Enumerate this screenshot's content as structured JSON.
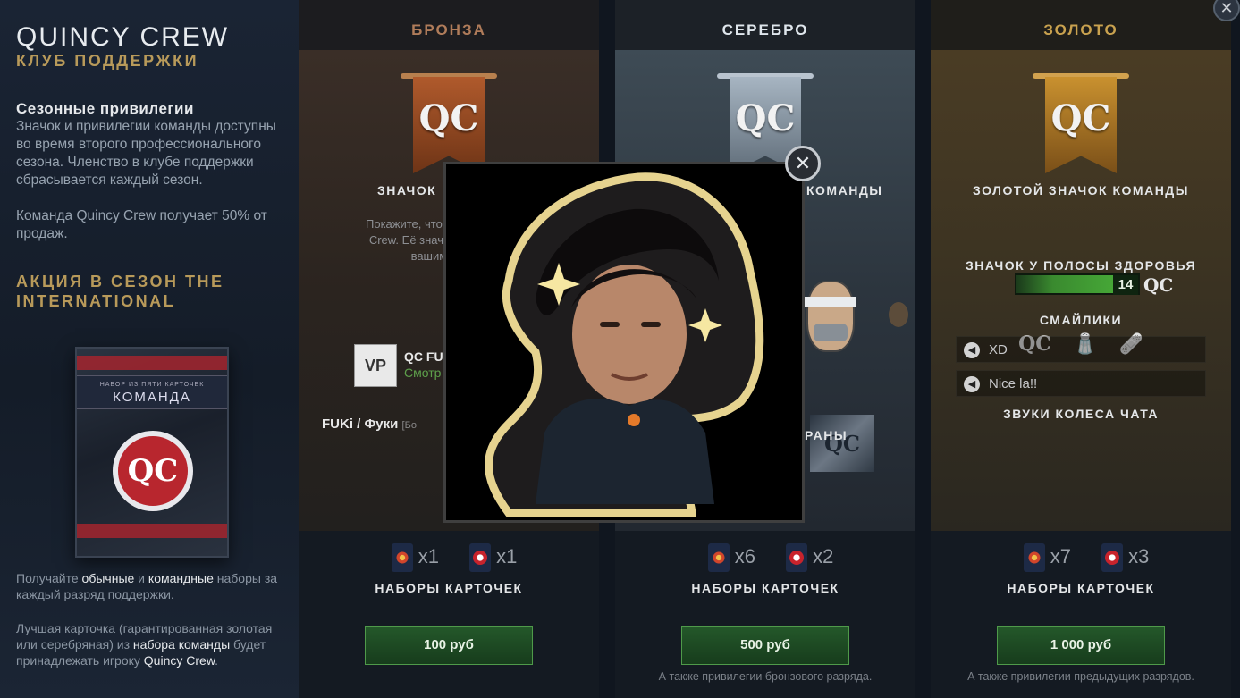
{
  "sidebar": {
    "brand": "QUINCY CREW",
    "subbrand": "КЛУБ ПОДДЕРЖКИ",
    "season_title": "Сезонные привилегии",
    "season_text": "Значок и привилегии команды доступны во время второго профессионального сезона. Членство в клубе поддержки сбрасывается каждый сезон.",
    "share_text": "Команда Quincy Crew получает 50% от продаж.",
    "promo_title": "АКЦИЯ В СЕЗОН THE INTERNATIONAL",
    "pack": {
      "subtitle": "НАБОР ИЗ ПЯТИ КАРТОЧЕК",
      "title": "КОМАНДА",
      "emblem": "QC"
    },
    "foot1": {
      "a": "Получайте ",
      "b": "обычные",
      "c": " и ",
      "d": "командные",
      "e": " наборы за каждый разряд поддержки."
    },
    "foot2": {
      "a": "Лучшая карточка (гарантированная золотая или серебряная) из ",
      "b": "набора команды",
      "c": " будет принадлежать игроку ",
      "d": "Quincy Crew",
      "e": "."
    }
  },
  "tiers": {
    "bronze": {
      "title": "БРОНЗА",
      "banner": "QC",
      "badge_label": "ЗНАЧОК",
      "desc": "Покажите, что под\nCrew. Её значок б\nвашим им",
      "player_tag": "QC FU",
      "player_link": "Смотр",
      "logo": "VP",
      "fuki": "FUKi / Фуки",
      "fuki_suffix": "[Бо",
      "packs": {
        "normal": "x1",
        "team": "x1"
      },
      "packs_label": "НАБОРЫ КАРТОЧЕК",
      "price": "100 руб",
      "also": ""
    },
    "silver": {
      "title": "СЕРЕБРО",
      "banner": "QC",
      "badge_label": "КОМАНДЫ",
      "screens_label": "РАНЫ",
      "screen_logo": "QC",
      "packs": {
        "normal": "x6",
        "team": "x2"
      },
      "packs_label": "НАБОРЫ КАРТОЧЕК",
      "price": "500 руб",
      "also": "А также привилегии бронзового разряда."
    },
    "gold": {
      "title": "ЗОЛОТО",
      "banner": "QC",
      "badge_label": "ЗОЛОТОЙ ЗНАЧОК КОМАНДЫ",
      "hp_value": "14",
      "hp_tag": "QC",
      "hp_label": "ЗНАЧОК У ПОЛОСЫ ЗДОРОВЬЯ",
      "emotes": [
        "QC",
        "🧂",
        "🩹"
      ],
      "emotes_label": "СМАЙЛИКИ",
      "chat": [
        "XD",
        "Nice la!!"
      ],
      "chat_label": "ЗВУКИ КОЛЕСА ЧАТА",
      "packs": {
        "normal": "x7",
        "team": "x3"
      },
      "packs_label": "НАБОРЫ КАРТОЧЕК",
      "price": "1 000 руб",
      "also": "А также привилегии предыдущих разрядов."
    }
  },
  "icons": {
    "close": "✕",
    "speaker": "◀"
  },
  "colors": {
    "bronze": "#b07c5a",
    "silver": "#dfe6ec",
    "gold": "#c9a24f",
    "accent_gold": "#b89a5a",
    "buy_green": "#24582a"
  }
}
